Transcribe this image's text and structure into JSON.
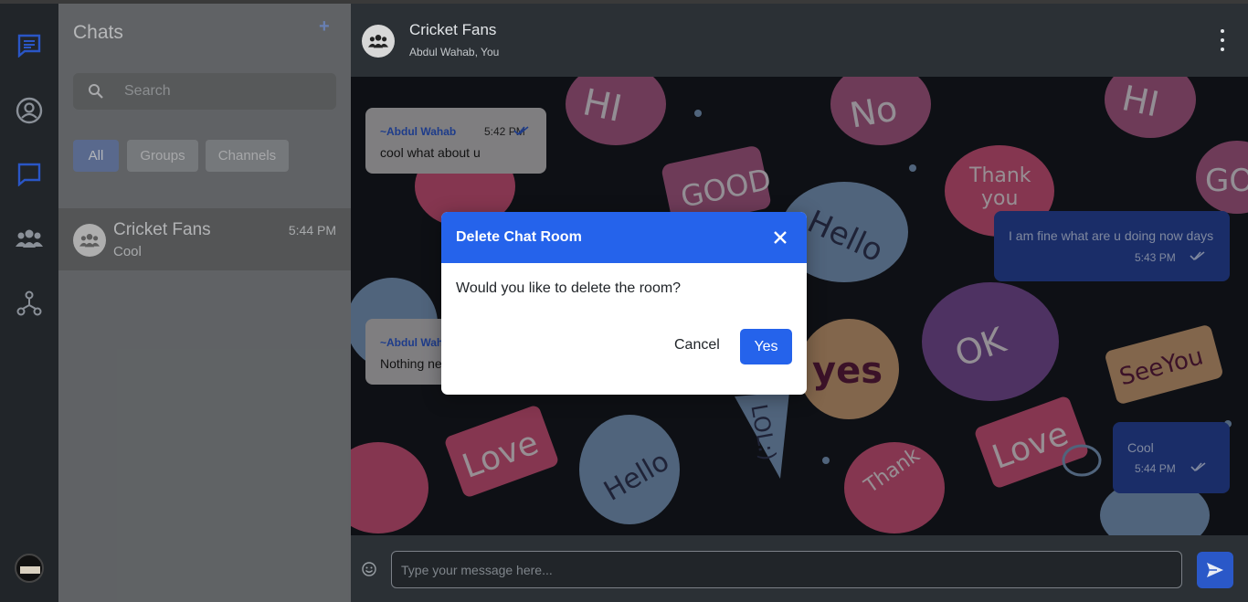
{
  "rail": {
    "icons": [
      "chat-bubble-icon",
      "user-circle-icon",
      "chat-outline-icon",
      "groups-icon",
      "network-icon"
    ],
    "accent": "#2a56c6"
  },
  "sidebar": {
    "title": "Chats",
    "add_label": "+",
    "search_placeholder": "Search",
    "filters": [
      "All",
      "Groups",
      "Channels"
    ],
    "active_filter": "All",
    "chats": [
      {
        "name": "Cricket Fans",
        "time": "5:44 PM",
        "last_message": "Cool"
      }
    ]
  },
  "header": {
    "title": "Cricket Fans",
    "subtitle": "Abdul Wahab, You"
  },
  "messages": [
    {
      "direction": "in",
      "author": "~Abdul Wahab",
      "time": "5:42 PM",
      "text": "cool what about u",
      "read": true
    },
    {
      "direction": "in",
      "author": "~Abdul Wahab",
      "time": "",
      "text": "Nothing ne",
      "read": false
    },
    {
      "direction": "out",
      "author": "",
      "time": "5:43 PM",
      "text": "I am fine what are u doing now days",
      "read": true
    },
    {
      "direction": "out",
      "author": "",
      "time": "5:44 PM",
      "text": "Cool",
      "read": true
    }
  ],
  "composer": {
    "placeholder": "Type your message here..."
  },
  "modal": {
    "title": "Delete Chat Room",
    "body": "Would you like to delete the room?",
    "cancel_label": "Cancel",
    "confirm_label": "Yes",
    "accent": "#2563eb"
  }
}
